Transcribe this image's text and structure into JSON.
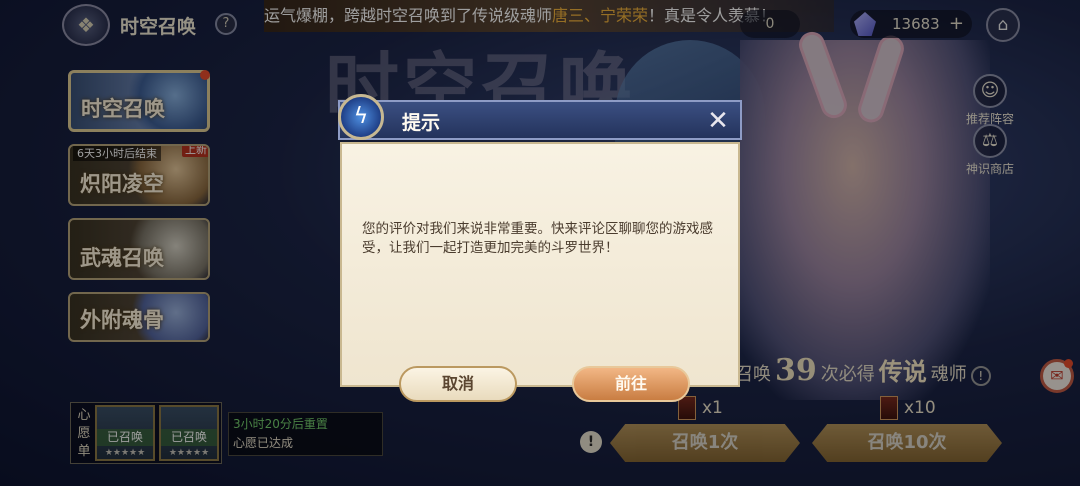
{
  "header": {
    "title": "时空召唤",
    "help_icon": "?",
    "ticker_prefix": "运气爆棚，跨越时空召唤到了传说级魂师",
    "ticker_names": "唐三、宁荣荣",
    "ticker_suffix": "！真是令人羡慕！",
    "currency_partial": "0",
    "gems": "13683",
    "add": "+"
  },
  "background": {
    "big_title": "时空召唤"
  },
  "sidebar": {
    "items": [
      {
        "label": "时空召唤"
      },
      {
        "label": "炽阳凌空",
        "timer": "6天3小时后结束",
        "badge": "上新"
      },
      {
        "label": "武魂召唤"
      },
      {
        "label": "外附魂骨"
      }
    ]
  },
  "right_menu": {
    "recommend": "推荐阵容",
    "shop": "神识商店"
  },
  "pity": {
    "prefix": "召唤",
    "count": "39",
    "middle": "次必得",
    "rarity": "传说",
    "suffix": "魂师",
    "help": "!"
  },
  "summon": {
    "single_cost": "x1",
    "ten_cost": "x10",
    "single_label": "召唤1次",
    "ten_label": "召唤10次",
    "warn": "!"
  },
  "wish": {
    "label": "心愿单",
    "slots": [
      {
        "status": "已召唤",
        "stars": "★★★★★"
      },
      {
        "status": "已召唤",
        "stars": "★★★★★"
      }
    ],
    "reset_timer": "3小时20分后重置",
    "status": "心愿已达成"
  },
  "dialog": {
    "title": "提示",
    "message": "您的评价对我们来说非常重要。快来评论区聊聊您的游戏感受，让我们一起打造更加完美的斗罗世界！",
    "cancel": "取消",
    "confirm": "前往"
  }
}
